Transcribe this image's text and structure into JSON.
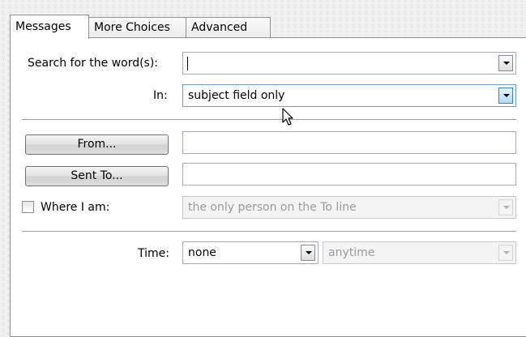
{
  "tabs": [
    {
      "label": "Messages",
      "active": true
    },
    {
      "label": "More Choices",
      "active": false
    },
    {
      "label": "Advanced",
      "active": false
    }
  ],
  "search": {
    "label": "Search for the word(s):",
    "value": "",
    "in_label": "In:",
    "in_value": "subject field only"
  },
  "from": {
    "button_label": "From...",
    "value": ""
  },
  "sent_to": {
    "button_label": "Sent To...",
    "value": ""
  },
  "where": {
    "label": "Where I am:",
    "checked": false,
    "value": "the only person on the To line"
  },
  "time": {
    "label": "Time:",
    "value": "none",
    "range_value": "anytime"
  }
}
